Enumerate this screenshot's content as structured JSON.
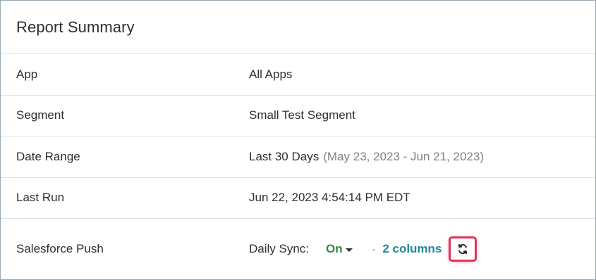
{
  "report": {
    "title": "Report Summary",
    "rows": [
      {
        "label": "App",
        "value": "All Apps"
      },
      {
        "label": "Segment",
        "value": "Small Test Segment"
      },
      {
        "label": "Date Range",
        "value": "Last 30 Days",
        "detail": "(May 23, 2023 - Jun 21, 2023)"
      },
      {
        "label": "Last Run",
        "value": "Jun 22, 2023 4:54:14 PM EDT"
      }
    ],
    "salesforce": {
      "label": "Salesforce Push",
      "sync_label": "Daily Sync:",
      "sync_state": "On",
      "separator": "·",
      "columns_link": "2 columns",
      "refresh_icon": "refresh-icon"
    }
  },
  "colors": {
    "sync_on": "#2e8b3d",
    "link": "#20889a",
    "highlight": "#e0335b"
  }
}
